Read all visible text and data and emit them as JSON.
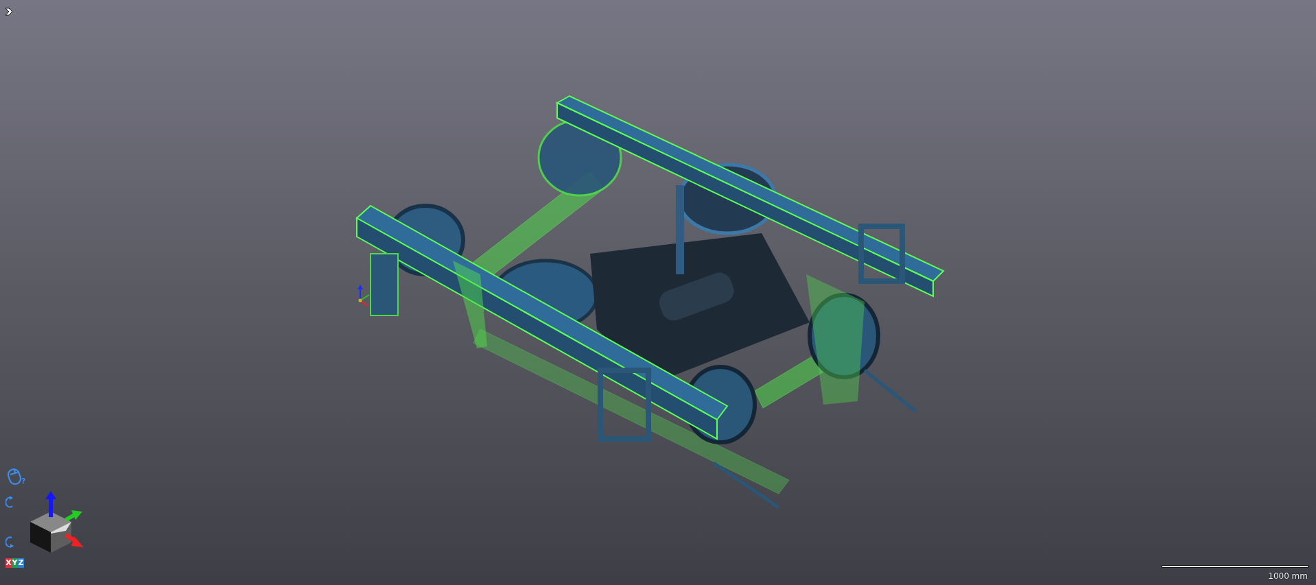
{
  "view_cube": {
    "axis_labels": [
      {
        "label": "X",
        "color": "#d9323f"
      },
      {
        "label": "Y",
        "color": "#1f9a55"
      },
      {
        "label": "Z",
        "color": "#2a7fd0"
      }
    ]
  },
  "scale_bar": {
    "label": "1000 mm"
  },
  "mouse_help": {
    "mark": "?"
  }
}
